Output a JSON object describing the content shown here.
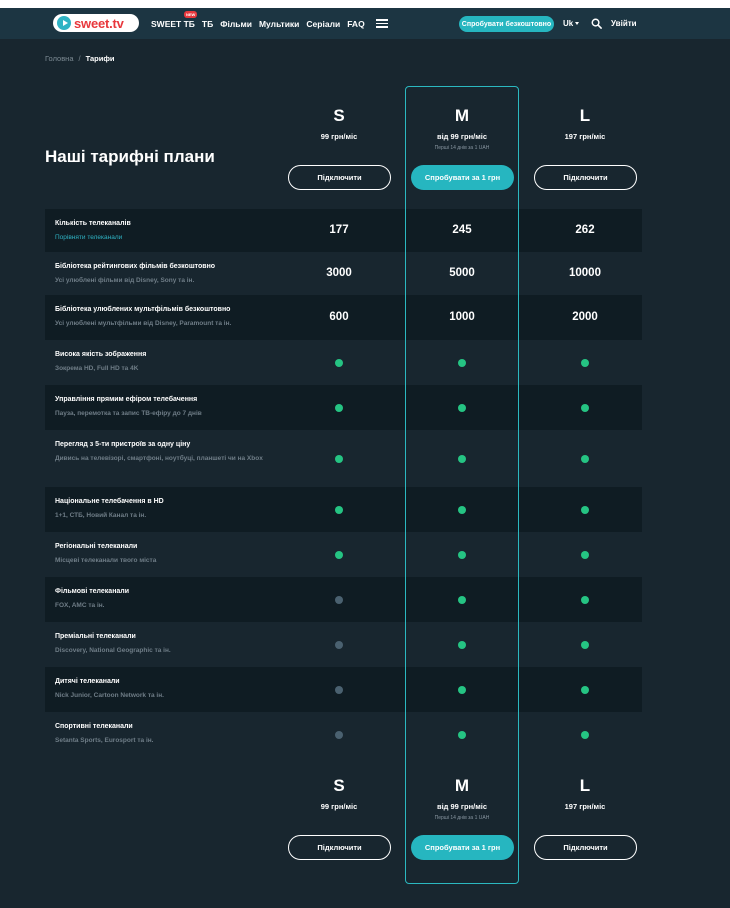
{
  "header": {
    "logo_text": "sweet.tv",
    "nav": [
      {
        "label": "SWEET ТБ",
        "badge": "NEW"
      },
      {
        "label": "ТБ"
      },
      {
        "label": "Фільми"
      },
      {
        "label": "Мультики"
      },
      {
        "label": "Серіали"
      },
      {
        "label": "FAQ"
      }
    ],
    "try_free_label": "Спробувати безкоштовно",
    "language": "Uk",
    "login_label": "Увійти"
  },
  "breadcrumb": {
    "home": "Головна",
    "separator": "/",
    "current": "Тарифи"
  },
  "page_title": "Наші тарифні плани",
  "plans": [
    {
      "letter": "S",
      "price": "99 грн/міс",
      "note": "",
      "button": "Підключити",
      "featured": false
    },
    {
      "letter": "M",
      "price": "від 99 грн/міс",
      "note": "Перші 14 днів за 1 UAH",
      "button": "Спробувати за 1 грн",
      "featured": true
    },
    {
      "letter": "L",
      "price": "197 грн/міс",
      "note": "",
      "button": "Підключити",
      "featured": false
    }
  ],
  "features": [
    {
      "title": "Кількість телеканалів",
      "subtitle": "",
      "link": "Порівняти телеканали",
      "type": "value",
      "values": [
        "177",
        "245",
        "262"
      ]
    },
    {
      "title": "Бібліотека рейтингових фільмів безкоштовно",
      "subtitle": "Усі улюблені фільми від Disney, Sony та ін.",
      "type": "value",
      "values": [
        "3000",
        "5000",
        "10000"
      ]
    },
    {
      "title": "Бібліотека улюблених мультфільмів безкоштовно",
      "subtitle": "Усі улюблені мультфільми від Disney, Paramount та ін.",
      "type": "value",
      "values": [
        "600",
        "1000",
        "2000"
      ]
    },
    {
      "title": "Висока якість зображення",
      "subtitle": "Зокрема HD, Full HD та 4K",
      "type": "check",
      "values": [
        true,
        true,
        true
      ]
    },
    {
      "title": "Управління прямим ефіром телебачення",
      "subtitle": "Пауза, перемотка та запис ТВ-ефіру до 7 днів",
      "type": "check",
      "values": [
        true,
        true,
        true
      ]
    },
    {
      "title": "Перегляд з 5-ти пристроїв за одну ціну",
      "subtitle": "Дивись на телевізорі, смартфоні, ноутбуці, планшеті чи на Xbox",
      "type": "check",
      "values": [
        true,
        true,
        true
      ]
    },
    {
      "title": "Національне телебачення в HD",
      "subtitle": "1+1, СТБ, Новий Канал та ін.",
      "type": "check",
      "values": [
        true,
        true,
        true
      ]
    },
    {
      "title": "Регіональні телеканали",
      "subtitle": "Місцеві телеканали твого міста",
      "type": "check",
      "values": [
        true,
        true,
        true
      ]
    },
    {
      "title": "Фільмові телеканали",
      "subtitle": "FOX, AMC та ін.",
      "type": "check",
      "values": [
        false,
        true,
        true
      ]
    },
    {
      "title": "Преміальні телеканали",
      "subtitle": "Discovery, National Geographic та ін.",
      "type": "check",
      "values": [
        false,
        true,
        true
      ]
    },
    {
      "title": "Дитячі телеканали",
      "subtitle": "Nick Junior, Cartoon Network та ін.",
      "type": "check",
      "values": [
        false,
        true,
        true
      ]
    },
    {
      "title": "Спортивні телеканали",
      "subtitle": "Setanta Sports, Eurosport та ін.",
      "type": "check",
      "values": [
        false,
        true,
        true
      ]
    }
  ],
  "colors": {
    "background": "#18262f",
    "header": "#1c3542",
    "accent": "#26b6c0",
    "check_on": "#25c483",
    "check_off": "#4a6170"
  }
}
